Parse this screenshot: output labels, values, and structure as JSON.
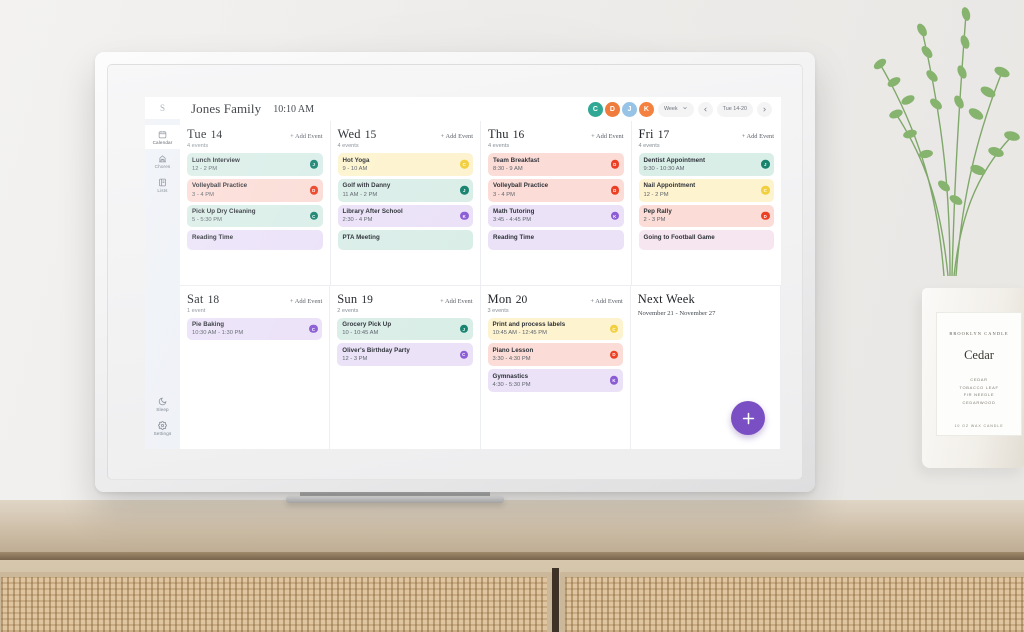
{
  "scene": {
    "candle": {
      "brand": "BROOKLYN CANDLE",
      "name": "Cedar",
      "notes": "CEDAR\nTOBACCO LEAF\nFIR NEEDLE\nCEDARWOOD",
      "footer": "10 OZ WAX CANDLE"
    }
  },
  "app": {
    "brand_initial": "S",
    "title": "Jones Family",
    "clock": "10:10 AM"
  },
  "sidebar": {
    "top_items": [
      {
        "label": "Calendar",
        "icon": "calendar-icon",
        "active": true
      },
      {
        "label": "Chores",
        "icon": "chores-icon",
        "active": false
      },
      {
        "label": "Lists",
        "icon": "lists-icon",
        "active": false
      }
    ],
    "bottom_items": [
      {
        "label": "Sleep",
        "icon": "moon-icon",
        "active": false
      },
      {
        "label": "Settings",
        "icon": "gear-icon",
        "active": false
      }
    ]
  },
  "topbar": {
    "avatars": [
      {
        "initial": "C",
        "color": "#2fa894"
      },
      {
        "initial": "D",
        "color": "#ef7c3c"
      },
      {
        "initial": "J",
        "color": "#97c3e6"
      },
      {
        "initial": "K",
        "color": "#f4813f"
      }
    ],
    "view_select": {
      "label": "Week",
      "caret": "⌄"
    },
    "prev_label": "‹",
    "date_range": "Tue 14-20",
    "next_label": "›"
  },
  "add_event_label": "+ Add Event",
  "fab": {
    "icon": "plus-icon",
    "color": "#7b4fc4"
  },
  "days": [
    {
      "name": "Tue",
      "num": "14",
      "count": "4 events",
      "events": [
        {
          "title": "Lunch Interview",
          "time": "12 - 2 PM",
          "bg": "#daeee8",
          "dot": "#17836f",
          "initial": "J"
        },
        {
          "title": "Volleyball Practice",
          "time": "3 - 4 PM",
          "bg": "#fbdcd6",
          "dot": "#ec3f23",
          "initial": "D"
        },
        {
          "title": "Pick Up Dry Cleaning",
          "time": "5 - 5:30 PM",
          "bg": "#daeee8",
          "dot": "#17836f",
          "initial": "C"
        },
        {
          "title": "Reading Time",
          "time": "",
          "bg": "#ebe2f8",
          "dot": "#8b5cd6",
          "initial": "K",
          "partial": true
        }
      ]
    },
    {
      "name": "Wed",
      "num": "15",
      "count": "4 events",
      "events": [
        {
          "title": "Hot Yoga",
          "time": "9 - 10 AM",
          "bg": "#fdf3cf",
          "dot": "#f2cf3e",
          "initial": "C"
        },
        {
          "title": "Golf with Danny",
          "time": "11 AM - 2 PM",
          "bg": "#daeee8",
          "dot": "#17836f",
          "initial": "J"
        },
        {
          "title": "Library After School",
          "time": "2:30 - 4 PM",
          "bg": "#ebe2f8",
          "dot": "#8b5cd6",
          "initial": "K"
        },
        {
          "title": "PTA Meeting",
          "time": "",
          "bg": "#daeee8",
          "dot": "#17836f",
          "initial": "C",
          "partial": true
        }
      ]
    },
    {
      "name": "Thu",
      "num": "16",
      "count": "4 events",
      "events": [
        {
          "title": "Team Breakfast",
          "time": "8:30 - 9 AM",
          "bg": "#fbdcd6",
          "dot": "#ec3f23",
          "initial": "D"
        },
        {
          "title": "Volleyball Practice",
          "time": "3 - 4 PM",
          "bg": "#fbdcd6",
          "dot": "#ec3f23",
          "initial": "D"
        },
        {
          "title": "Math Tutoring",
          "time": "3:45 - 4:45 PM",
          "bg": "#ebe2f8",
          "dot": "#8b5cd6",
          "initial": "K"
        },
        {
          "title": "Reading Time",
          "time": "",
          "bg": "#ebe2f8",
          "dot": "#8b5cd6",
          "initial": "K",
          "partial": true
        }
      ]
    },
    {
      "name": "Fri",
      "num": "17",
      "count": "4 events",
      "events": [
        {
          "title": "Dentist Appointment",
          "time": "9:30 - 10:30 AM",
          "bg": "#daeee8",
          "dot": "#17836f",
          "initial": "J"
        },
        {
          "title": "Nail Appointment",
          "time": "12 - 2 PM",
          "bg": "#fdf3cf",
          "dot": "#f2cf3e",
          "initial": "C"
        },
        {
          "title": "Pep Rally",
          "time": "2 - 3 PM",
          "bg": "#fbdcd6",
          "dot": "#ec3f23",
          "initial": "D"
        },
        {
          "title": "Going to Football Game",
          "time": "",
          "bg": "#f6e6f0",
          "dot": "#8b5cd6",
          "initial": "K",
          "partial": true
        }
      ]
    }
  ],
  "days2": [
    {
      "name": "Sat",
      "num": "18",
      "count": "1 event",
      "events": [
        {
          "title": "Pie Baking",
          "time": "10:30 AM - 1:30 PM",
          "bg": "#ebe2f8",
          "dot": "#8b5cd6",
          "initial": "C"
        }
      ]
    },
    {
      "name": "Sun",
      "num": "19",
      "count": "2 events",
      "events": [
        {
          "title": "Grocery Pick Up",
          "time": "10 - 10:45 AM",
          "bg": "#daeee8",
          "dot": "#17836f",
          "initial": "J"
        },
        {
          "title": "Oliver's Birthday Party",
          "time": "12 - 3 PM",
          "bg": "#ebe2f8",
          "dot": "#8b5cd6",
          "initial": "C"
        }
      ]
    },
    {
      "name": "Mon",
      "num": "20",
      "count": "3 events",
      "events": [
        {
          "title": "Print and process labels",
          "time": "10:45 AM - 12:45 PM",
          "bg": "#fdf3cf",
          "dot": "#f2cf3e",
          "initial": "C"
        },
        {
          "title": "Piano Lesson",
          "time": "3:30 - 4:30 PM",
          "bg": "#fbdcd6",
          "dot": "#ec3f23",
          "initial": "D"
        },
        {
          "title": "Gymnastics",
          "time": "4:30 - 5:30 PM",
          "bg": "#ebe2f8",
          "dot": "#8b5cd6",
          "initial": "K"
        }
      ]
    }
  ],
  "next_week": {
    "title": "Next Week",
    "range": "November 21 - November 27"
  }
}
